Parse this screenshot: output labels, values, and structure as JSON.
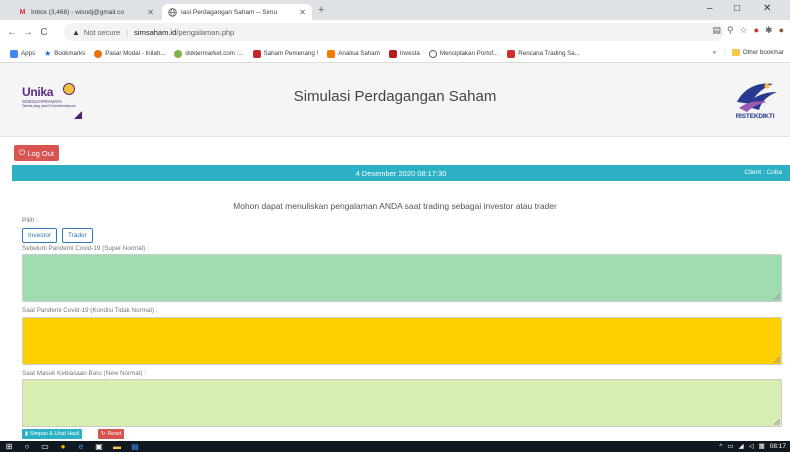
{
  "browser": {
    "tabs": [
      {
        "title": "Inbox (3,468) - wisndj@gmail.co",
        "icon": "gmail-icon",
        "color": "#d93025"
      },
      {
        "title": "Iasi Perdagangan Saham -- Simu",
        "icon": "globe-icon",
        "color": "#5f6368"
      }
    ],
    "new_tab": "+",
    "window_controls": [
      "–",
      "□",
      "✕"
    ],
    "address": {
      "security": "Not secure",
      "host": "simsaham.id",
      "path": "/pengalaman.php"
    },
    "bookmarks": [
      {
        "label": "Apps",
        "icon": "apps-grid-icon",
        "color": "#4285f4"
      },
      {
        "label": "Bookmarks",
        "icon": "star-icon",
        "color": "#1a73e8"
      },
      {
        "label": "Pasar Modal - Inilah...",
        "icon": "pasar-modal-icon",
        "color": "#e8710a"
      },
      {
        "label": "doktermarket.com :...",
        "icon": "doktermarket-icon",
        "color": "#7cb342"
      },
      {
        "label": "Saham Pemenang !",
        "icon": "saham-pemenang-icon",
        "color": "#c62828"
      },
      {
        "label": "Analisa Saham",
        "icon": "blogger-icon",
        "color": "#f57c00"
      },
      {
        "label": "Investa",
        "icon": "investa-icon",
        "color": "#b71c1c"
      },
      {
        "label": "Menciptakan Portof...",
        "icon": "globe-icon",
        "color": "#5f6368"
      },
      {
        "label": "Rencana Trading Sa...",
        "icon": "rencana-icon",
        "color": "#d32f2f"
      }
    ],
    "bookmarks_overflow": "»",
    "other_bookmarks": "Other bookmar"
  },
  "page": {
    "logo_left": {
      "name": "Unika",
      "sub1": "SOEGIJAPRANATA",
      "sub2": "Talenta yang peduli & berkemampuan"
    },
    "site_title": "Simulasi Perdagangan Saham",
    "logo_right": "RISTEKDIKTI",
    "logout_label": "Log Out",
    "date_text": "4 Desember 2020 08:17:30",
    "client_text": "Client : Coba",
    "prompt": "Mohon dapat menuliskan pengalaman ANDA saat trading sebagai investor atau trader",
    "pilih_label": "Pilih :",
    "roles": [
      "Investor",
      "Trader"
    ],
    "fields": [
      {
        "label": "Sebelum Pandemi Covid-19 (Super Normal) :",
        "value": "",
        "color": "#9fdcae"
      },
      {
        "label": "Saat Pandemi Covid-19 (Kondisi Tidak Normal) :",
        "value": "",
        "color": "#ffd000"
      },
      {
        "label": "Saat Masuk Kebiasaan Baru (New Normal) :",
        "value": "",
        "color": "#d7edb2"
      }
    ],
    "save_label": "Simpan & Lihat Hasil",
    "reset_label": "Reset"
  },
  "taskbar": {
    "time": "08:17"
  }
}
